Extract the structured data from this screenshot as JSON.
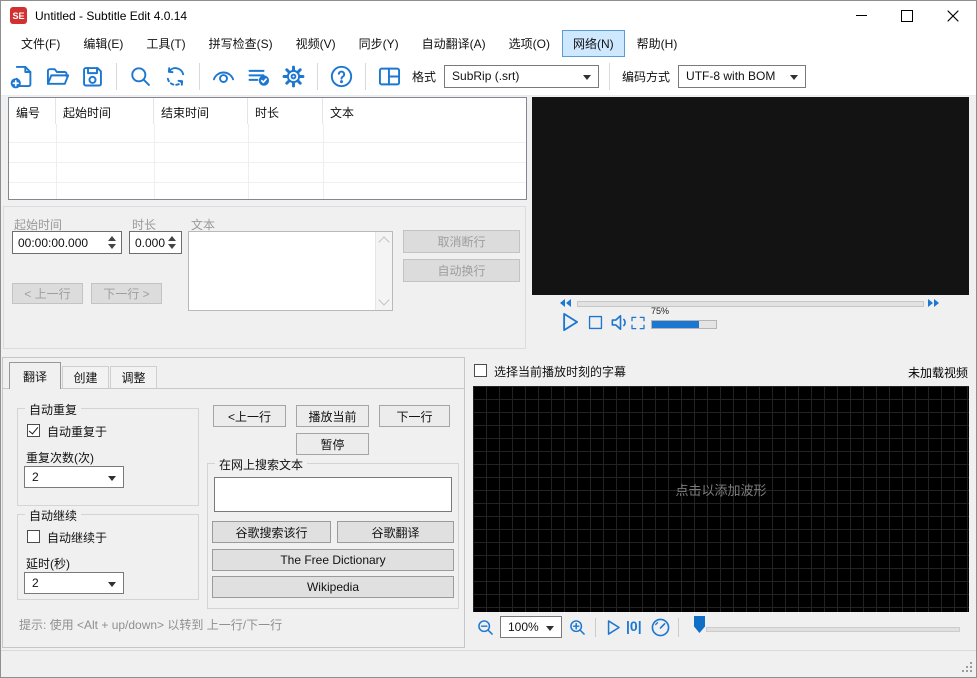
{
  "titlebar": {
    "logo_text": "SE",
    "title": "Untitled - Subtitle Edit 4.0.14"
  },
  "menu": {
    "items": [
      "文件(F)",
      "编辑(E)",
      "工具(T)",
      "拼写检查(S)",
      "视频(V)",
      "同步(Y)",
      "自动翻译(A)",
      "选项(O)",
      "网络(N)",
      "帮助(H)"
    ],
    "active_item": "网络(N)"
  },
  "toolbar": {
    "icons": [
      "new-file",
      "open-file",
      "save",
      "find",
      "replace",
      "visual-sync",
      "spell-check",
      "settings",
      "help",
      "layout"
    ],
    "format_label": "格式",
    "format_value": "SubRip (.srt)",
    "encoding_label": "编码方式",
    "encoding_value": "UTF-8 with BOM"
  },
  "list": {
    "columns": [
      "编号",
      "起始时间",
      "结束时间",
      "时长",
      "文本"
    ]
  },
  "editor": {
    "start_label": "起始时间",
    "start_value": "00:00:00.000",
    "duration_label": "时长",
    "duration_value": "0.000",
    "text_label": "文本",
    "unbreak_button": "取消断行",
    "auto_break_button": "自动换行",
    "prev_button": "< 上一行",
    "next_button": "下一行 >"
  },
  "video": {
    "volume": "75%"
  },
  "translate_panel": {
    "tabs": [
      "翻译",
      "创建",
      "调整"
    ],
    "auto_repeat_title": "自动重复",
    "auto_repeat_checkbox": "自动重复于",
    "repeat_count_label": "重复次数(次)",
    "repeat_count_value": "2",
    "auto_continue_title": "自动继续",
    "auto_continue_checkbox": "自动继续于",
    "delay_label": "延时(秒)",
    "delay_value": "2",
    "prev_line_button": "<上一行",
    "play_current_button": "播放当前",
    "next_line_button": "下一行",
    "pause_button": "暂停",
    "search_group_title": "在网上搜索文本",
    "search_value": "",
    "google_search_button": "谷歌搜索该行",
    "google_translate_button": "谷歌翻译",
    "free_dictionary_button": "The Free Dictionary",
    "wikipedia_button": "Wikipedia",
    "hint": "提示: 使用 <Alt + up/down> 以转到 上一行/下一行"
  },
  "waveform_panel": {
    "select_current_label": "选择当前播放时刻的字幕",
    "video_status": "未加载视频",
    "placeholder": "点击以添加波形",
    "zoom_value": "100%",
    "goto_zero_glyph": "|0|"
  },
  "colors": {
    "accent_blue": "#1c77d0",
    "menu_highlight": "#cde8ff",
    "logo_red": "#d23131",
    "video_bg": "#131313",
    "waveform_bg": "#000000"
  }
}
